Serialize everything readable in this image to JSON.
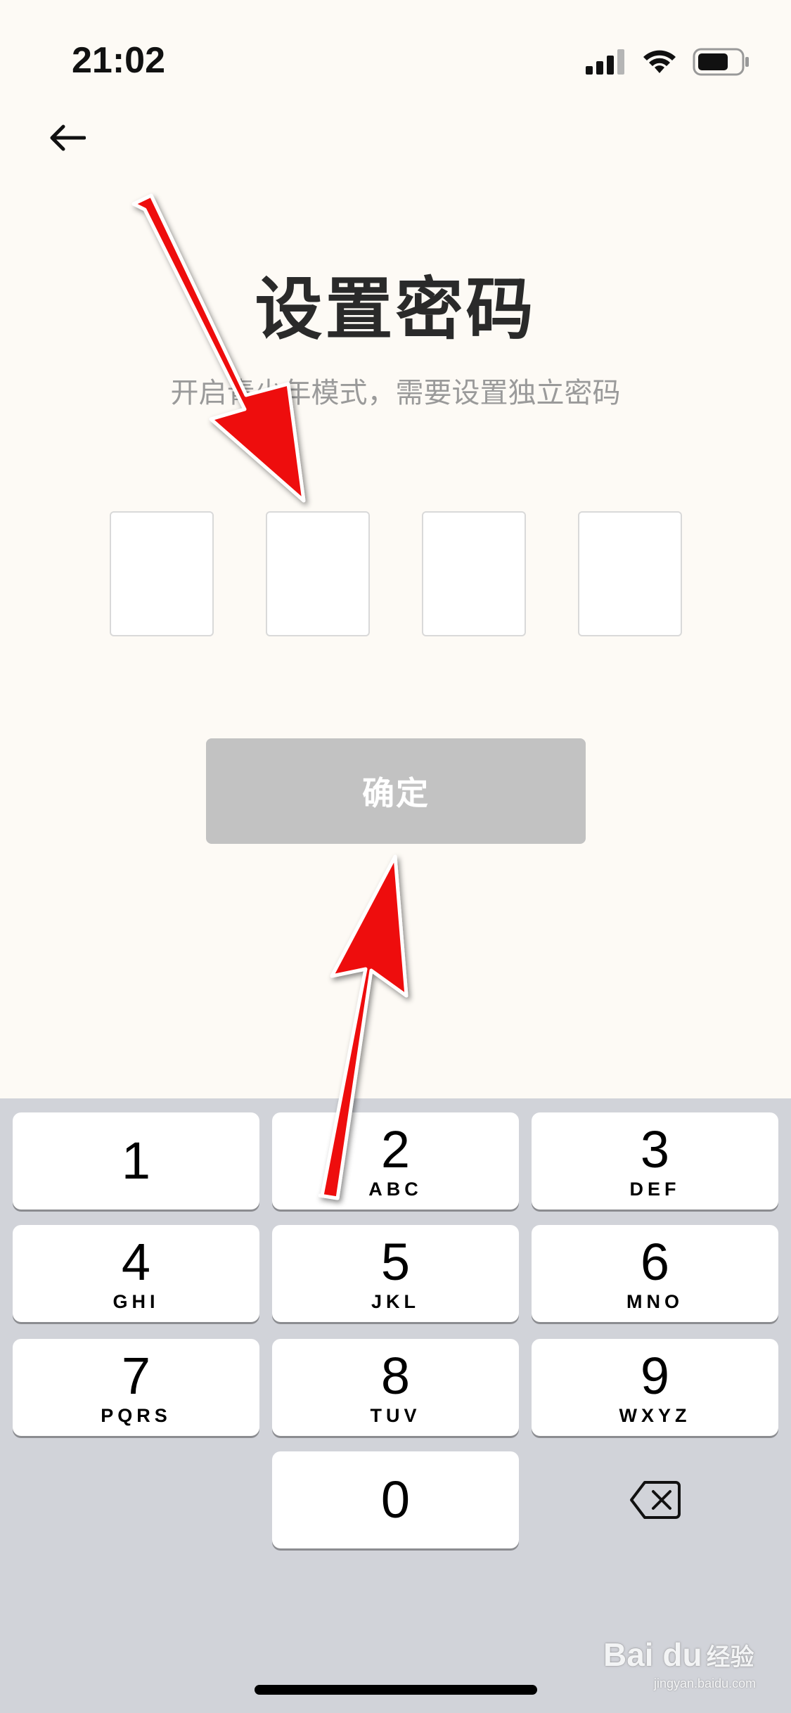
{
  "status_bar": {
    "time": "21:02",
    "icons": [
      "signal-icon",
      "wifi-icon",
      "battery-icon"
    ]
  },
  "header": {
    "back_icon": "arrow-left-icon"
  },
  "main": {
    "title": "设置密码",
    "subtitle": "开启青少年模式，需要设置独立密码",
    "pin_length": 4,
    "confirm_label": "确定"
  },
  "keypad": {
    "keys": [
      {
        "digit": "1",
        "letters": ""
      },
      {
        "digit": "2",
        "letters": "ABC"
      },
      {
        "digit": "3",
        "letters": "DEF"
      },
      {
        "digit": "4",
        "letters": "GHI"
      },
      {
        "digit": "5",
        "letters": "JKL"
      },
      {
        "digit": "6",
        "letters": "MNO"
      },
      {
        "digit": "7",
        "letters": "PQRS"
      },
      {
        "digit": "8",
        "letters": "TUV"
      },
      {
        "digit": "9",
        "letters": "WXYZ"
      },
      {
        "digit": "0",
        "letters": ""
      }
    ],
    "delete_icon": "backspace-icon"
  },
  "watermark": {
    "logo": "Bai du",
    "label": "经验",
    "url": "jingyan.baidu.com"
  },
  "colors": {
    "background": "#fdfaf5",
    "button_disabled": "#c2c2c2",
    "keypad_bg": "#d1d3d9",
    "annotation_arrow": "#ee1111"
  }
}
